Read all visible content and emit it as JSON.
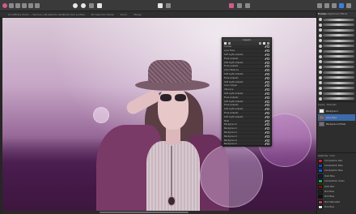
{
  "toolbar": {
    "left_icons": [
      "app-logo-icon",
      "persona-photo-icon",
      "persona-liquify-icon",
      "persona-develop-icon",
      "persona-tone-icon",
      "persona-export-icon"
    ],
    "center_icons": [
      "undo-icon",
      "redo-icon",
      "arrange-icon",
      "mode-icon",
      "color-wheel-icon",
      "snapping-icon",
      "pink-swatch-icon",
      "mask-icon",
      "quickmask-icon"
    ],
    "right_icons": [
      "studio-icon",
      "assistant-icon",
      "settings-icon",
      "help-icon",
      "view-icon"
    ]
  },
  "context_bar": {
    "items": [
      "[U] Affinity Photo — Woman_Hat.afphoto (RGBA/8) (ICC profile)",
      "No Selection Made",
      "Zoom",
      "Merge"
    ]
  },
  "layers_panel": {
    "title": "Layers",
    "rows": [
      {
        "name": "Curves",
        "checked": true
      },
      {
        "name": "Lens Flare",
        "checked": true
      },
      {
        "name": "Soft Light (Adjust)",
        "checked": true
      },
      {
        "name": "Flare (Adjust)",
        "checked": true
      },
      {
        "name": "Soft Light (Adjust)",
        "checked": true
      },
      {
        "name": "Flare (Adjust)",
        "checked": true
      },
      {
        "name": "Color Balance",
        "checked": true
      },
      {
        "name": "Soft Light (Adjust)",
        "checked": true
      },
      {
        "name": "Flare (Adjust)",
        "checked": true
      },
      {
        "name": "Soft Light (Adjust)",
        "checked": true
      },
      {
        "name": "Color Adjust",
        "checked": true
      },
      {
        "name": "Vibrance",
        "checked": true
      },
      {
        "name": "Soft Light (Adjust)",
        "checked": true
      },
      {
        "name": "Flare (Adjust)",
        "checked": true
      },
      {
        "name": "Soft Light (Adjust)",
        "checked": true
      },
      {
        "name": "Flare (Adjust)",
        "checked": true
      },
      {
        "name": "Soft Light (Adjust)",
        "checked": true
      },
      {
        "name": "Flare (Adjust)",
        "checked": true
      },
      {
        "name": "Soft Light (Adjust)",
        "checked": true
      },
      {
        "name": "Pixel",
        "checked": true
      },
      {
        "name": "Background",
        "checked": true
      },
      {
        "name": "Background",
        "checked": true
      },
      {
        "name": "Background",
        "checked": true
      },
      {
        "name": "Background",
        "checked": true
      },
      {
        "name": "Background",
        "checked": true
      },
      {
        "name": "Background",
        "checked": true
      }
    ]
  },
  "right_panel": {
    "tabs": [
      "Brushes",
      "Adjustment",
      "Effects"
    ],
    "brush_count": 16,
    "layers_tabs": [
      "Layers",
      "Channels"
    ],
    "layers": [
      {
        "name": "Background",
        "thumb": "white",
        "selected": false
      },
      {
        "name": "Lens Flare",
        "thumb": "photo",
        "selected": true
      },
      {
        "name": "Background (Pixel)",
        "thumb": "photo",
        "selected": false
      }
    ],
    "swatch_tabs": [
      "Swatches",
      "Color"
    ],
    "swatches": [
      {
        "name": "Composition Red",
        "color": "#d21f2b"
      },
      {
        "name": "Composition Blue",
        "color": "#1f3fd2"
      },
      {
        "name": "Composition Blue",
        "color": "#1f5ad2"
      },
      {
        "name": "Dark Blue",
        "color": "#0d1a5e"
      },
      {
        "name": "Composition Green",
        "color": "#1fa84a"
      },
      {
        "name": "Dark Red",
        "color": "#7a1010"
      },
      {
        "name": "Pink Blue",
        "color": "#222222"
      },
      {
        "name": "Pink Blue",
        "color": "#111111"
      },
      {
        "name": "Pink Saturated",
        "color": "#c0307a"
      },
      {
        "name": "Pink Blue",
        "color": "#e0e0e0"
      }
    ]
  }
}
